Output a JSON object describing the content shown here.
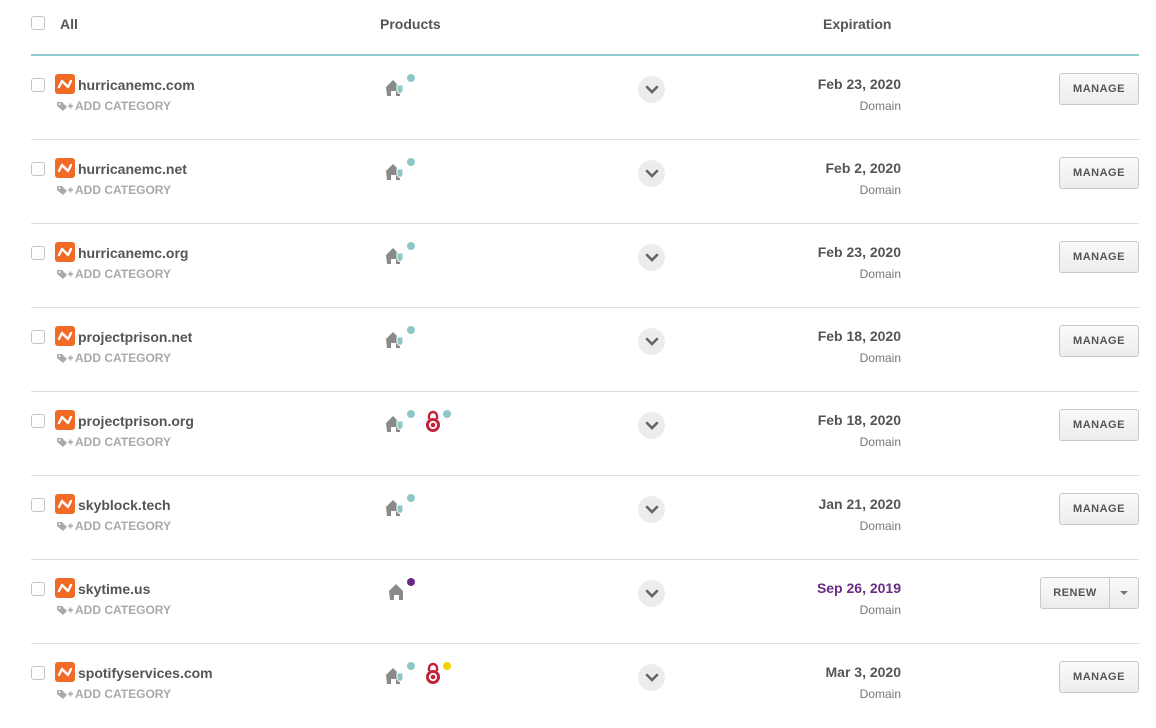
{
  "header": {
    "all_label": "All",
    "products_label": "Products",
    "expiration_label": "Expiration"
  },
  "colors": {
    "brand": "#f06a25",
    "teal_status": "#8cc8c8",
    "purple_status": "#6a2b86",
    "yellow_status": "#f5d000",
    "ssl_red": "#c4223a"
  },
  "rows": [
    {
      "domain": "hurricanemc.com",
      "add_category": "ADD CATEGORY",
      "products": [
        "hosting-shield-icon"
      ],
      "expiration": "Feb 23, 2020",
      "type": "Domain",
      "action": "MANAGE"
    },
    {
      "domain": "hurricanemc.net",
      "add_category": "ADD CATEGORY",
      "products": [
        "hosting-shield-icon"
      ],
      "expiration": "Feb 2, 2020",
      "type": "Domain",
      "action": "MANAGE"
    },
    {
      "domain": "hurricanemc.org",
      "add_category": "ADD CATEGORY",
      "products": [
        "hosting-shield-icon"
      ],
      "expiration": "Feb 23, 2020",
      "type": "Domain",
      "action": "MANAGE"
    },
    {
      "domain": "projectprison.net",
      "add_category": "ADD CATEGORY",
      "products": [
        "hosting-shield-icon"
      ],
      "expiration": "Feb 18, 2020",
      "type": "Domain",
      "action": "MANAGE"
    },
    {
      "domain": "projectprison.org",
      "add_category": "ADD CATEGORY",
      "products": [
        "hosting-shield-icon",
        "ssl-lock-icon"
      ],
      "expiration": "Feb 18, 2020",
      "type": "Domain",
      "action": "MANAGE"
    },
    {
      "domain": "skyblock.tech",
      "add_category": "ADD CATEGORY",
      "products": [
        "hosting-shield-icon"
      ],
      "expiration": "Jan 21, 2020",
      "type": "Domain",
      "action": "MANAGE"
    },
    {
      "domain": "skytime.us",
      "add_category": "ADD CATEGORY",
      "products": [
        "hosting-icon"
      ],
      "expiration": "Sep 26, 2019",
      "type": "Domain",
      "action": "RENEW"
    },
    {
      "domain": "spotifyservices.com",
      "add_category": "ADD CATEGORY",
      "products": [
        "hosting-shield-icon",
        "ssl-lock-icon"
      ],
      "expiration": "Mar 3, 2020",
      "type": "Domain",
      "action": "MANAGE"
    }
  ]
}
